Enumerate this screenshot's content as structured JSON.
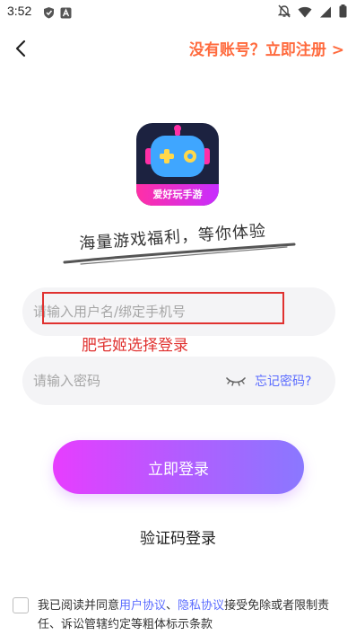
{
  "status_bar": {
    "time": "3:52",
    "left_icons": [
      "shield-icon",
      "a-badge-icon"
    ],
    "right_icons": [
      "mute-bell-icon",
      "wifi-icon",
      "signal-icon",
      "battery-icon"
    ]
  },
  "header": {
    "back_icon": "chevron-left-icon",
    "register_link": "没有账号？立即注册 >"
  },
  "logo": {
    "banner_text": "爱好玩手游",
    "colors": {
      "background": "#1c2240",
      "face": "#3fa6ff",
      "eyes": "#ffd84a",
      "banner": "#ff2fa6"
    }
  },
  "slogan": "海量游戏福利，等你体验",
  "form": {
    "username_placeholder": "请输入用户名/绑定手机号",
    "password_placeholder": "请输入密码",
    "password_visibility_icon": "eye-closed-icon",
    "forgot_password": "忘记密码?"
  },
  "annotation": {
    "text": "肥宅姬选择登录",
    "color": "#e0312f"
  },
  "login_button": "立即登录",
  "sms_login": "验证码登录",
  "agreement": {
    "prefix": "我已阅读并同意",
    "user_agreement": "用户协议",
    "separator": "、",
    "privacy_agreement": "隐私协议",
    "suffix": "接受免除或者限制责任、诉讼管辖约定等粗体标示条款",
    "checked": false
  },
  "colors": {
    "accent_orange": "#ff6a3d",
    "link_blue": "#5b6cff",
    "button_gradient_start": "#e73dff",
    "button_gradient_end": "#8a78ff"
  }
}
